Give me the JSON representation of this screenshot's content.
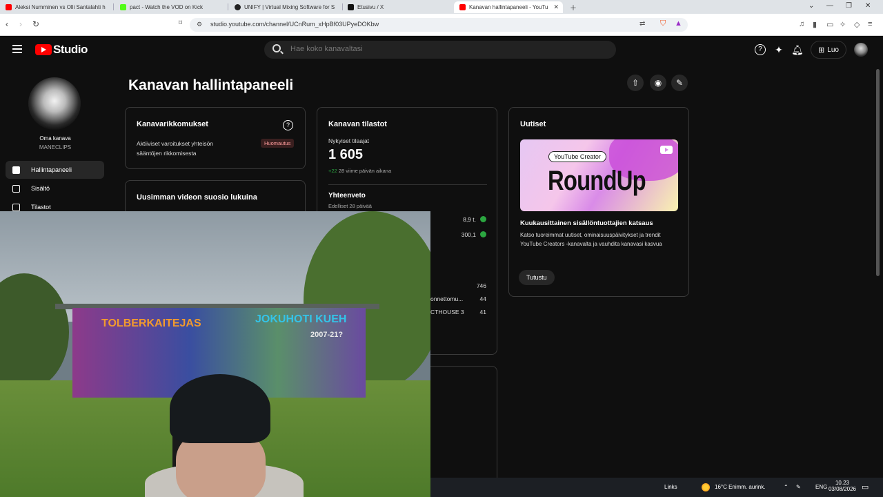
{
  "browser": {
    "tabs": [
      {
        "title": "Aleksi Numminen vs Olli Santalahti h",
        "favicon_color": "#ff0000"
      },
      {
        "title": "pact - Watch the VOD on Kick",
        "favicon_color": "#53fc18"
      },
      {
        "title": "UNIFY | Virtual Mixing Software for S",
        "favicon_color": "#222222"
      },
      {
        "title": "Etusivu / X",
        "favicon_color": "#111111"
      },
      {
        "title": "Kanavan hallintapaneeli - YouTube",
        "favicon_color": "#ff0000"
      }
    ],
    "url": "studio.youtube.com/channel/UCnRum_xHpBf03UPyeDOKbw"
  },
  "header": {
    "logo_text": "Studio",
    "search_placeholder": "Hae koko kanavaltasi",
    "create_label": "Luo"
  },
  "sidebar": {
    "channel_label": "Oma kanava",
    "channel_name": "MANECLIPS",
    "items": [
      {
        "label": "Hallintapaneeli",
        "icon": "dashboard-icon",
        "active": true
      },
      {
        "label": "Sisältö",
        "icon": "content-icon",
        "active": false
      },
      {
        "label": "Tilastot",
        "icon": "analytics-icon",
        "active": false
      }
    ]
  },
  "main": {
    "title": "Kanavan hallintapaneeli",
    "violations": {
      "title": "Kanavarikkomukset",
      "text": "Aktiiviset varoitukset yhteisön sääntöjen rikkomisesta",
      "badge": "Huomautus"
    },
    "latest_video": {
      "title": "Uusimman videon suosio lukuina"
    },
    "stats": {
      "title": "Kanavan tilastot",
      "subs_label": "Nykyiset tilaajat",
      "subs_value": "1 605",
      "subs_change": "+22",
      "subs_change_text": "28 viime päivän aikana",
      "summary_title": "Yhteenveto",
      "summary_period": "Edelliset 28 päivää",
      "summary_values": [
        "8,9 t.",
        "300,1"
      ],
      "top_values": [
        "746",
        "44",
        "41"
      ],
      "top_titles": [
        "onnettomu...",
        "CTHOUSE 3"
      ]
    },
    "news": {
      "title": "Uutiset",
      "thumb_pill": "YouTube Creator",
      "thumb_title": "RoundUp",
      "headline": "Kuukausittainen sisällöntuottajien katsaus",
      "description": "Katso tuoreimmat uutiset, ominaisuuspäivitykset ja trendit YouTube Creators -kanavalta ja vauhdita kanavasi kasvua",
      "button": "Tutustu"
    }
  },
  "webcam": {
    "wall_text_left": "TOLBERKAITEJAS",
    "wall_text_right": "JOKUHOTI KUEH",
    "wall_text_year": "2007-21?"
  },
  "taskbar": {
    "links_label": "Links",
    "weather": "16°C Enimm. aurink.",
    "lang": "ENG",
    "time": "10.23",
    "date": "03/08/2026"
  },
  "colors": {
    "accent_red": "#ff0000",
    "positive_green": "#2ba640",
    "background": "#0f0f0f"
  }
}
